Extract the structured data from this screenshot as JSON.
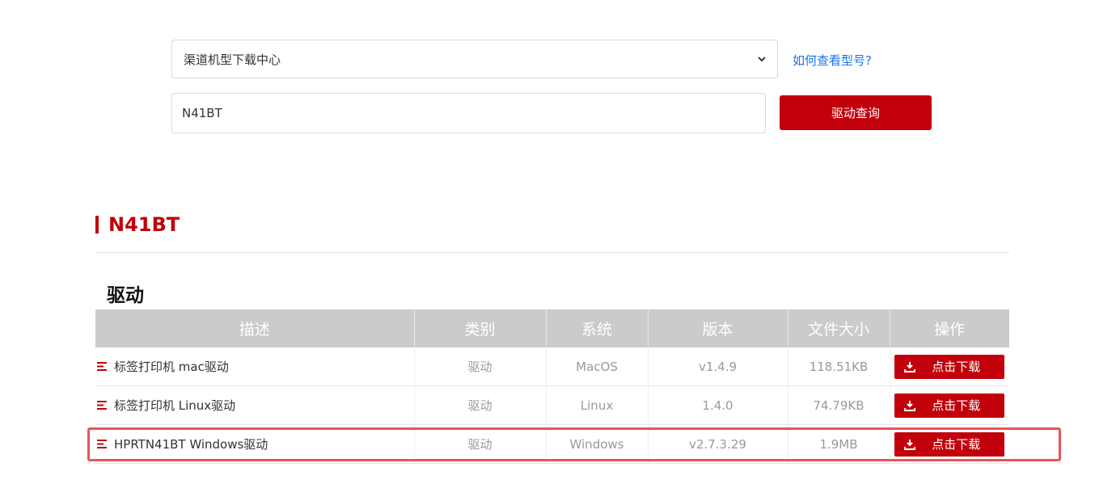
{
  "search": {
    "category_select_value": "渠道机型下载中心",
    "help_link": "如何查看型号?",
    "model_input_value": "N41BT",
    "query_button": "驱动查询"
  },
  "model": {
    "title": "N41BT"
  },
  "section": {
    "title": "驱动"
  },
  "table": {
    "headers": [
      "描述",
      "类别",
      "系统",
      "版本",
      "文件大小",
      "操作"
    ],
    "rows": [
      {
        "description": "标签打印机 mac驱动",
        "category": "驱动",
        "system": "MacOS",
        "version": "v1.4.9",
        "size": "118.51KB",
        "action": "点击下载"
      },
      {
        "description": "标签打印机 Linux驱动",
        "category": "驱动",
        "system": "Linux",
        "version": "1.4.0",
        "size": "74.79KB",
        "action": "点击下载"
      },
      {
        "description": "HPRTN41BT Windows驱动",
        "category": "驱动",
        "system": "Windows",
        "version": "v2.7.3.29",
        "size": "1.9MB",
        "action": "点击下载"
      }
    ]
  },
  "colors": {
    "accent": "#c1000b",
    "link": "#1a73e8",
    "header_bg": "#cbcbcb",
    "highlight": "#e8545b"
  }
}
